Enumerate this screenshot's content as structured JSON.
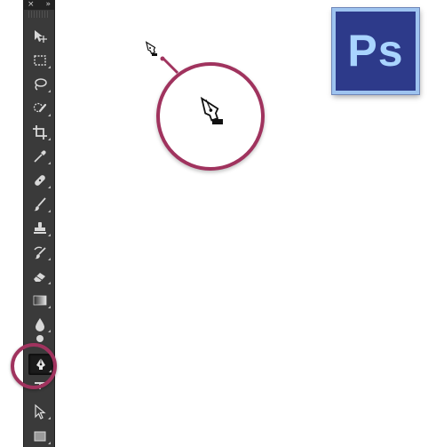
{
  "toolbar": {
    "close_glyph": "×",
    "collapse_glyph": "»",
    "tools": [
      {
        "name": "move-tool",
        "icon": "move-icon"
      },
      {
        "name": "rectangular-marquee-tool",
        "icon": "marquee-icon"
      },
      {
        "name": "lasso-tool",
        "icon": "lasso-icon"
      },
      {
        "name": "quick-selection-tool",
        "icon": "quick-selection-icon"
      },
      {
        "name": "crop-tool",
        "icon": "crop-icon"
      },
      {
        "name": "eyedropper-tool",
        "icon": "eyedropper-icon"
      },
      {
        "name": "spot-healing-brush-tool",
        "icon": "healing-icon"
      },
      {
        "name": "brush-tool",
        "icon": "brush-icon"
      },
      {
        "name": "clone-stamp-tool",
        "icon": "stamp-icon"
      },
      {
        "name": "history-brush-tool",
        "icon": "history-brush-icon"
      },
      {
        "name": "eraser-tool",
        "icon": "eraser-icon"
      },
      {
        "name": "gradient-tool",
        "icon": "gradient-icon"
      },
      {
        "name": "blur-tool",
        "icon": "blur-icon"
      },
      {
        "name": "dodge-tool",
        "icon": "dodge-icon"
      },
      {
        "name": "pen-tool",
        "icon": "pen-icon",
        "active": true
      },
      {
        "name": "type-tool",
        "icon": "type-icon"
      },
      {
        "name": "path-selection-tool",
        "icon": "path-selection-icon"
      },
      {
        "name": "rectangle-tool",
        "icon": "rectangle-icon"
      }
    ]
  },
  "callout": {
    "cursor_icon": "pen-cursor-icon",
    "highlight_color": "#a0335e"
  },
  "logo": {
    "text": "Ps",
    "background": "#2d3a8a",
    "text_color": "#a9d4ff",
    "border_color": "#9ec3ef"
  }
}
